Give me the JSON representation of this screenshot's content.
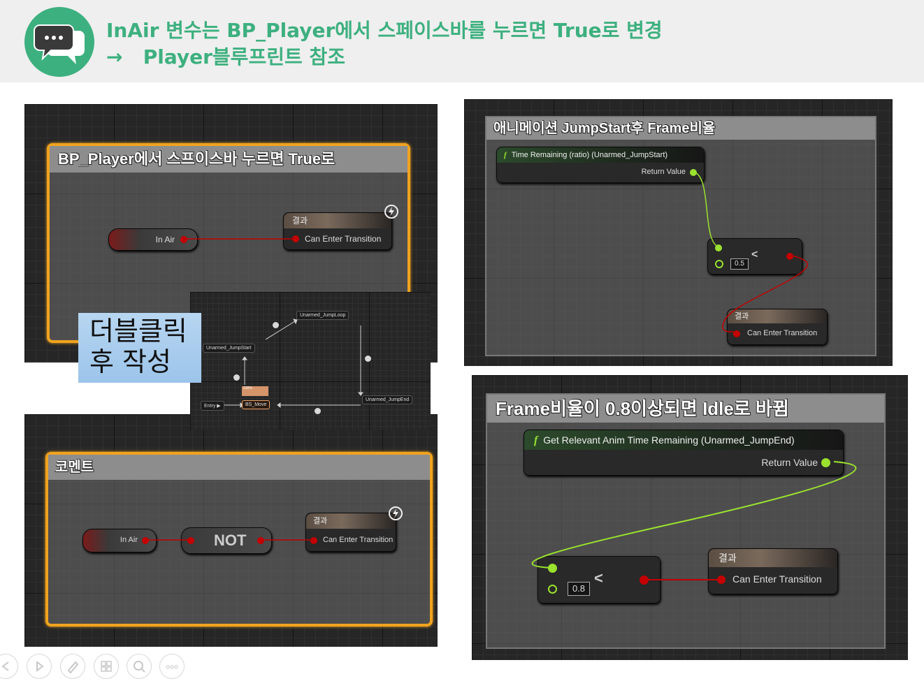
{
  "header": {
    "line1": "InAir 변수는  BP_Player에서 스페이스바를 누르면 True로 변경",
    "line2_arrow": "→",
    "line2": "Player블루프린트 참조",
    "accent": "#3db07f"
  },
  "panel_a": {
    "comment": "BP_Player에서 스프이스바 누르면 True로",
    "in_air": "In Air",
    "result_head": "결과",
    "result_pin": "Can Enter Transition"
  },
  "state_machine": {
    "entry": "Entry",
    "bs_move": "BS_Move",
    "jump_start": "Unarmed_JumpStart",
    "jump_loop": "Unarmed_JumpLoop",
    "jump_end": "Unarmed_JumpEnd",
    "tag_percent": "100%"
  },
  "callout": {
    "line1": "더블클릭",
    "line2": "후 작성"
  },
  "panel_b": {
    "comment": "코멘트",
    "in_air": "In Air",
    "not": "NOT",
    "result_head": "결과",
    "result_pin": "Can Enter Transition"
  },
  "panel_c": {
    "comment": "애니메이션 JumpStart후 Frame비율",
    "func_title": "Time Remaining (ratio) (Unarmed_JumpStart)",
    "return_value": "Return Value",
    "op": "<",
    "value": "0.5",
    "result_head": "결과",
    "result_pin": "Can Enter Transition"
  },
  "panel_d": {
    "comment": "Frame비율이 0.8이상되면 Idle로 바뀜",
    "func_title": "Get Relevant Anim Time Remaining (Unarmed_JumpEnd)",
    "return_value": "Return Value",
    "op": "<",
    "value": "0.8",
    "result_head": "결과",
    "result_pin": "Can Enter Transition"
  },
  "icons": {
    "chat": "chat-bubbles-icon",
    "func": "function-icon",
    "lightning": "lightning-icon"
  },
  "colors": {
    "exec_red": "#c40000",
    "float_green": "#9ae22e",
    "comment_orange": "#f0a31f"
  }
}
